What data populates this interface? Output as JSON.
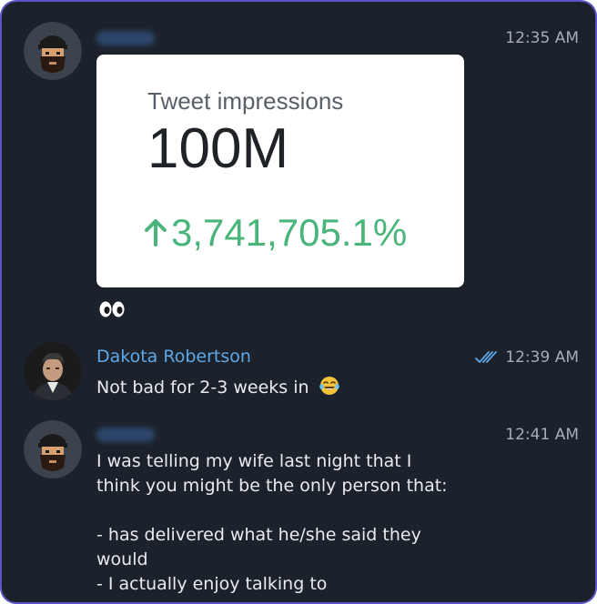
{
  "messages": [
    {
      "sender_name": "",
      "time": "12:35 AM",
      "card": {
        "label": "Tweet impressions",
        "value": "100M",
        "delta": "3,741,705.1%"
      }
    },
    {
      "sender_name": "Dakota Robertson",
      "time": "12:39 AM",
      "text": "Not bad for 2-3 weeks in"
    },
    {
      "sender_name": "",
      "time": "12:41 AM",
      "lines": [
        "I was telling my wife last night that I",
        "think you might be the only person that:",
        "",
        "- has delivered what he/she said they",
        "would",
        "- I actually enjoy talking to"
      ]
    }
  ],
  "colors": {
    "background": "#1c222c",
    "frame_border": "#5b55c8",
    "name": "#5fa8e8",
    "timestamp": "#a6adb8",
    "positive": "#4ab57a"
  }
}
